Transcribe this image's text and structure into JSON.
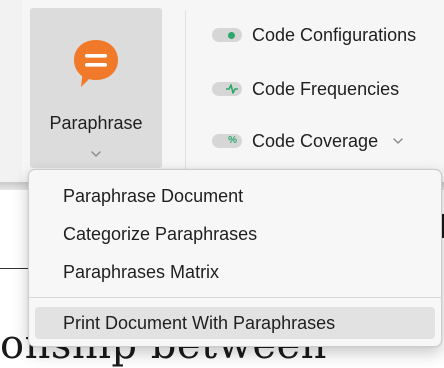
{
  "ribbon": {
    "paraphrase_button": {
      "label": "Paraphrase",
      "icon": "speech-bubble-icon",
      "icon_color": "#f07a2a"
    },
    "items": [
      {
        "label": "Code Configurations",
        "icon": "code-configurations-toggle-icon"
      },
      {
        "label": "Code Frequencies",
        "icon": "code-frequencies-toggle-icon"
      },
      {
        "label": "Code Coverage",
        "icon": "code-coverage-toggle-icon",
        "has_dropdown": true
      }
    ],
    "accent_color": "#2ba86a"
  },
  "menu": {
    "items": [
      {
        "label": "Paraphrase Document"
      },
      {
        "label": "Categorize Paraphrases"
      },
      {
        "label": "Paraphrases Matrix"
      },
      {
        "label": "Print Document With Paraphrases",
        "highlighted": true
      }
    ]
  },
  "document": {
    "visible_text": "onship between"
  }
}
